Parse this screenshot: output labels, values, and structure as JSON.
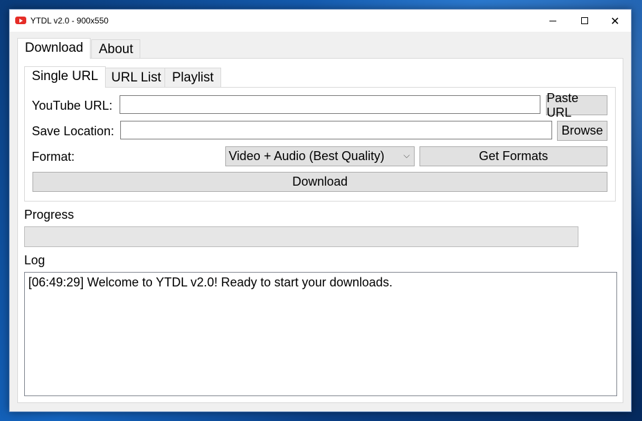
{
  "window": {
    "title": "YTDL v2.0 - 900x550",
    "icon": "youtube-icon"
  },
  "outer_tabs": [
    {
      "label": "Download",
      "active": true
    },
    {
      "label": "About",
      "active": false
    }
  ],
  "inner_tabs": [
    {
      "label": "Single URL",
      "active": true
    },
    {
      "label": "URL List",
      "active": false
    },
    {
      "label": "Playlist",
      "active": false
    }
  ],
  "form": {
    "url_label": "YouTube URL:",
    "url_value": "",
    "paste_button": "Paste URL",
    "save_label": "Save Location:",
    "save_value": "",
    "browse_button": "Browse",
    "format_label": "Format:",
    "format_selected": "Video + Audio (Best Quality)",
    "get_formats_button": "Get Formats",
    "download_button": "Download"
  },
  "progress": {
    "label": "Progress",
    "value": 0
  },
  "log": {
    "label": "Log",
    "lines": [
      "[06:49:29] Welcome to YTDL v2.0! Ready to start your downloads."
    ]
  },
  "colors": {
    "accent": "#e52d27",
    "progress_fill": "#06b025"
  }
}
